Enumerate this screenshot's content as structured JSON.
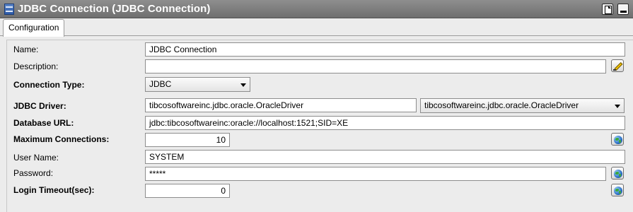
{
  "window": {
    "title": "JDBC Connection (JDBC Connection)"
  },
  "tabs": [
    {
      "label": "Configuration",
      "active": true
    }
  ],
  "form": {
    "name": {
      "label": "Name:",
      "value": "JDBC Connection"
    },
    "description": {
      "label": "Description:",
      "value": ""
    },
    "connection_type": {
      "label": "Connection Type:",
      "value": "JDBC"
    },
    "jdbc_driver": {
      "label": "JDBC Driver:",
      "value": "tibcosoftwareinc.jdbc.oracle.OracleDriver",
      "dropdown_value": "tibcosoftwareinc.jdbc.oracle.OracleDriver"
    },
    "database_url": {
      "label": "Database URL:",
      "value": "jdbc:tibcosoftwareinc:oracle://localhost:1521;SID=XE"
    },
    "max_connections": {
      "label": "Maximum Connections:",
      "value": "10"
    },
    "user_name": {
      "label": "User Name:",
      "value": "SYSTEM"
    },
    "password": {
      "label": "Password:",
      "value": "*****"
    },
    "login_timeout": {
      "label": "Login Timeout(sec):",
      "value": "0"
    }
  },
  "icons": {
    "title": "database-icon",
    "document_button": "document-icon",
    "minimize_button": "minimize-icon",
    "edit": "pencil-icon",
    "global_variable": "globe-icon"
  }
}
